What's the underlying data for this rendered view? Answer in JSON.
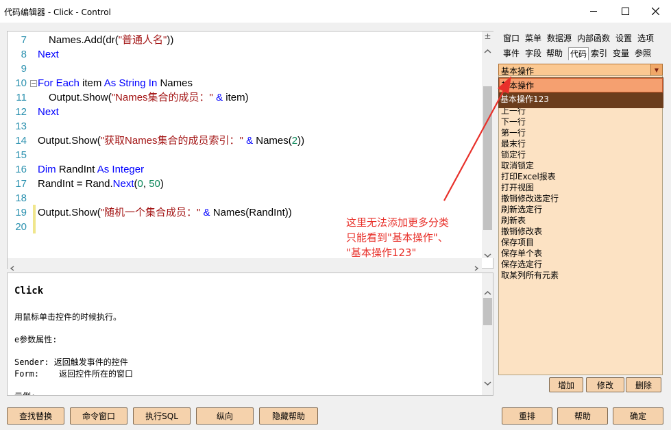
{
  "window": {
    "title": "代码编辑器 - Click - Control",
    "minimize_glyph": "—",
    "maximize_glyph": "☐",
    "close_glyph": "✕"
  },
  "editor": {
    "lines": [
      {
        "n": "7",
        "t": "Names.Add(dr(\"普通人名\"))"
      },
      {
        "n": "8",
        "t": "Next"
      },
      {
        "n": "9",
        "t": ""
      },
      {
        "n": "10",
        "t": "For Each item As String In Names"
      },
      {
        "n": "11",
        "t": "Output.Show(\"Names集合的成员：\" & item)"
      },
      {
        "n": "12",
        "t": "Next"
      },
      {
        "n": "13",
        "t": ""
      },
      {
        "n": "14",
        "t": "Output.Show(\"获取Names集合的成员索引：\" & Names(2))"
      },
      {
        "n": "15",
        "t": ""
      },
      {
        "n": "16",
        "t": "Dim RandInt As Integer"
      },
      {
        "n": "17",
        "t": "RandInt = Rand.Next(0, 50)"
      },
      {
        "n": "18",
        "t": ""
      },
      {
        "n": "19",
        "t": "Output.Show(\"随机一个集合成员：\" & Names(RandInt))"
      },
      {
        "n": "20",
        "t": ""
      }
    ],
    "split_glyph": "±"
  },
  "help": {
    "title": "Click",
    "lines": [
      "用鼠标单击控件的时候执行。",
      "",
      "e参数属性:",
      "",
      "Sender: 返回触发事件的控件",
      "Form:    返回控件所在的窗口",
      "",
      "示例:"
    ]
  },
  "bottom_buttons": [
    "查找替换",
    "命令窗口",
    "执行SQL",
    "纵向",
    "隐藏帮助"
  ],
  "right_bottom_buttons": [
    "重排",
    "帮助",
    "确定"
  ],
  "right_panel": {
    "tabs_row1": [
      "窗口",
      "菜单",
      "数据源",
      "内部函数",
      "设置",
      "选项"
    ],
    "tabs_row2": [
      "事件",
      "字段",
      "帮助",
      "代码",
      "索引",
      "变量",
      "参照"
    ],
    "active_tab": "代码",
    "combo_value": "基本操作",
    "combo_arrow": "▼",
    "dropdown_options": [
      "基本操作",
      "基本操作123"
    ],
    "list_items": [
      "上一行",
      "下一行",
      "第一行",
      "最末行",
      "锁定行",
      "取消锁定",
      "打印Excel报表",
      "打开视图",
      "撤销修改选定行",
      "刷新选定行",
      "刷新表",
      "撤销修改表",
      "保存项目",
      "保存单个表",
      "保存选定行",
      "取某列所有元素"
    ],
    "action_buttons": [
      "增加",
      "修改",
      "删除"
    ]
  },
  "annotation": {
    "lines": [
      "这里无法添加更多分类",
      "只能看到\"基本操作\"、",
      "\"基本操作123\""
    ]
  },
  "colors": {
    "accent_orange": "#fbc891",
    "list_bg": "#fce2c3",
    "annotation_red": "#e8302a",
    "keyword_blue": "#0000ff",
    "string_red": "#a31515"
  }
}
